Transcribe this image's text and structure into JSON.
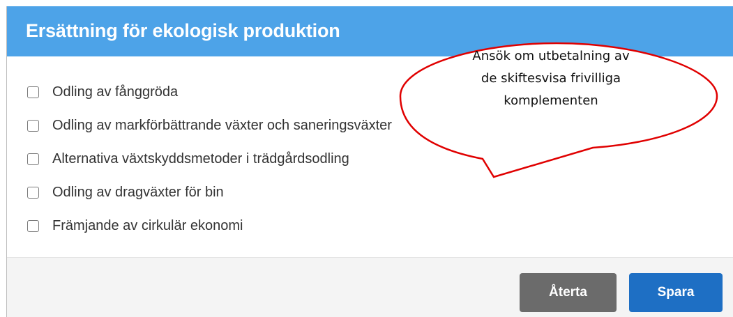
{
  "dialog": {
    "title": "Ersättning för ekologisk produktion",
    "options": [
      {
        "label": "Odling av fånggröda",
        "checked": false
      },
      {
        "label": "Odling av markförbättrande växter och saneringsväxter",
        "checked": false
      },
      {
        "label": "Alternativa växtskyddsmetoder i trädgårdsodling",
        "checked": false
      },
      {
        "label": "Odling av dragväxter för bin",
        "checked": false
      },
      {
        "label": "Främjande av cirkulär ekonomi",
        "checked": false
      }
    ],
    "buttons": {
      "cancel_label": "Återta",
      "save_label": "Spara"
    }
  },
  "callout": {
    "lines": [
      "Ansök om utbetalning av",
      "de skiftesvisa frivilliga",
      "komplementen"
    ],
    "border_color": "#e00000"
  },
  "colors": {
    "header": "#4da3e8",
    "save_button": "#1e6fc4",
    "cancel_button": "#6b6b6b",
    "footer": "#f4f4f4"
  }
}
